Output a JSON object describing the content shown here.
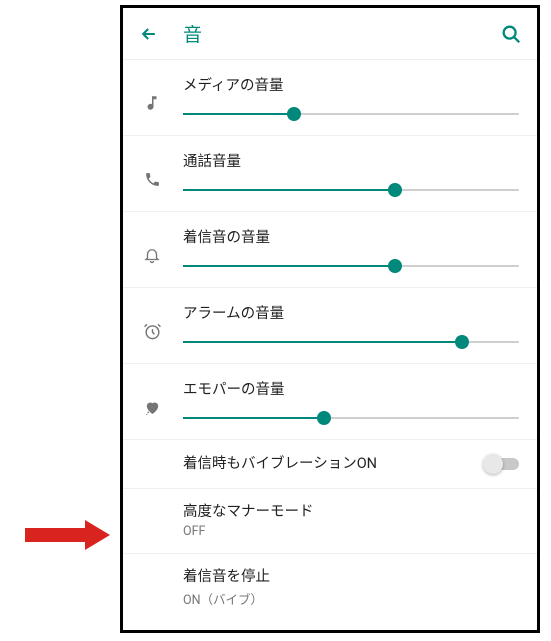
{
  "header": {
    "title": "音"
  },
  "sliders": [
    {
      "icon": "music-note",
      "label": "メディアの音量",
      "value": 33
    },
    {
      "icon": "phone",
      "label": "通話音量",
      "value": 63
    },
    {
      "icon": "bell",
      "label": "着信音の音量",
      "value": 63
    },
    {
      "icon": "alarm",
      "label": "アラームの音量",
      "value": 83
    },
    {
      "icon": "heart",
      "label": "エモパーの音量",
      "value": 42
    }
  ],
  "settings": [
    {
      "title": "着信時もバイブレーションON",
      "subtitle": "",
      "toggle": true,
      "toggleOn": false
    },
    {
      "title": "高度なマナーモード",
      "subtitle": "OFF",
      "toggle": false
    },
    {
      "title": "着信音を停止",
      "subtitle": "ON（バイブ）",
      "toggle": false
    }
  ],
  "colors": {
    "accent": "#00897b",
    "arrow": "#d8231f"
  }
}
